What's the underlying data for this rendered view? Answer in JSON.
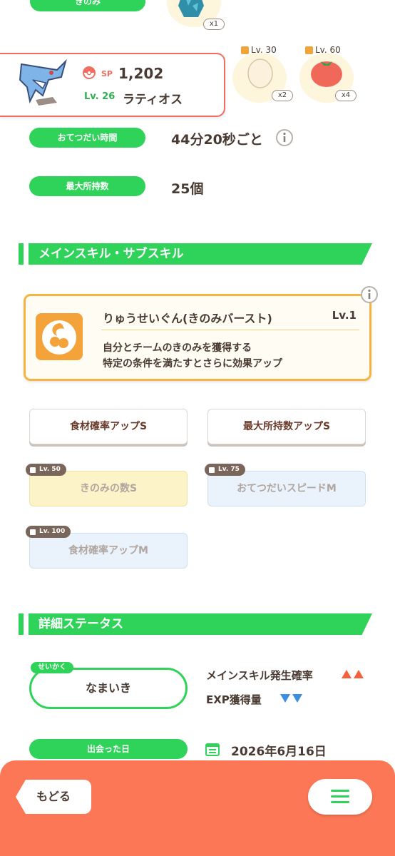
{
  "top_strip": {
    "berry_label": "きのみ",
    "berry_count": "x1",
    "ingredients": [
      {
        "lock_level": "Lv. 30",
        "count": "x2"
      },
      {
        "lock_level": "Lv. 60",
        "count": "x4"
      }
    ]
  },
  "pokemon": {
    "sp_label": "SP",
    "sp_value": "1,202",
    "level": "Lv. 26",
    "name": "ラティオス"
  },
  "stats": {
    "help_time_label": "おてつだい時間",
    "help_time_value": "44分20秒ごと",
    "max_carry_label": "最大所持数",
    "max_carry_value": "25個"
  },
  "skills_section": {
    "title": "メインスキル・サブスキル",
    "main_skill": {
      "name": "りゅうせいぐん(きのみバースト)",
      "level": "Lv.1",
      "desc_line1": "自分とチームのきのみを獲得する",
      "desc_line2": "特定の条件を満たすとさらに効果アップ"
    },
    "sub_skills": [
      {
        "label": "食材確率アップS"
      },
      {
        "label": "最大所持数アップS"
      },
      {
        "label": "きのみの数S",
        "lock": "Lv. 50"
      },
      {
        "label": "おてつだいスピードM",
        "lock": "Lv. 75"
      },
      {
        "label": "食材確率アップM",
        "lock": "Lv. 100"
      }
    ]
  },
  "details_section": {
    "title": "詳細ステータス",
    "nature_tag": "せいかく",
    "nature_value": "なまいき",
    "up_stat": "メインスキル発生確率",
    "down_stat": "EXP獲得量",
    "met_date_label": "出会った日",
    "met_date_value": "2026年6月16日"
  },
  "bottom": {
    "back_label": "もどる"
  },
  "colors": {
    "green": "#2fd35a",
    "coral": "#fb7756",
    "berry_gold": "#f4b443",
    "up_arrow": "#f2623c",
    "down_arrow": "#3a8fe0"
  }
}
